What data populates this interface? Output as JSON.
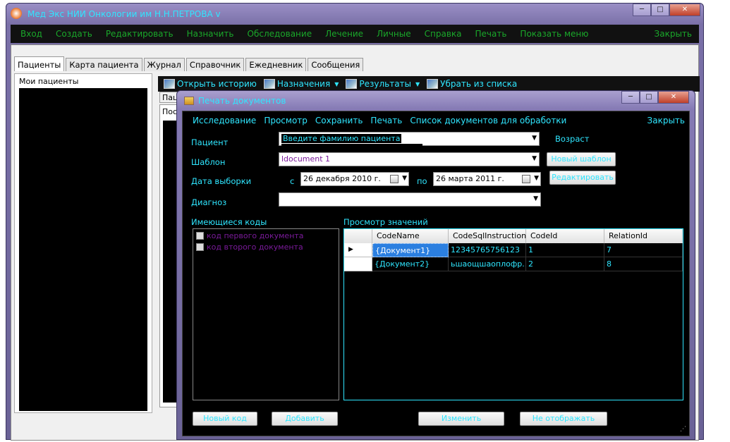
{
  "main_window": {
    "title": "Мед Экс НИИ Онкологии им Н.Н.ПЕТРОВА v",
    "menu": [
      "Вход",
      "Создать",
      "Редактировать",
      "Назначить",
      "Обследование",
      "Лечение",
      "Личные",
      "Справка",
      "Печать",
      "Показать меню"
    ],
    "close_label": "Закрыть",
    "tabs": [
      "Пациенты",
      "Карта пациента",
      "Журнал",
      "Справочник",
      "Ежедневник",
      "Сообщения"
    ],
    "left_group_label": "Мои пациенты",
    "toolbar": [
      {
        "label": "Открыть историю",
        "icon": "image-icon",
        "dropdown": false
      },
      {
        "label": "Назначения",
        "icon": "image-icon",
        "dropdown": true
      },
      {
        "label": "Результаты",
        "icon": "image-icon",
        "dropdown": true
      },
      {
        "label": "Убрать из списка",
        "icon": "image-icon",
        "dropdown": false
      }
    ],
    "subtab_fragment": "Пациенты",
    "subpanel_fragment": "Последние"
  },
  "dialog": {
    "title": "Печать документов",
    "menu": [
      "Исследование",
      "Просмотр",
      "Сохранить",
      "Печать",
      "Список документов для обработки"
    ],
    "close_label": "Закрыть",
    "patient_label": "Пациент",
    "patient_value": "Введите фамилию пациента",
    "age_label": "Возраст",
    "template_label": "Шаблон",
    "template_value": "ldocument 1",
    "new_template_button": "Новый шаблон",
    "date_label": "Дата выборки",
    "from_label": "с",
    "to_label": "по",
    "date_from": "26 декабря  2010 г.",
    "date_to": "26   марта   2011 г.",
    "edit_button": "Редактировать",
    "diagnosis_label": "Диагноз",
    "diagnosis_value": "",
    "codes_label": "Имеющиеся коды",
    "codes": [
      "код первого документа",
      "код второго документа"
    ],
    "preview_label": "Просмотр значений",
    "grid": {
      "columns": [
        "CodeName",
        "CodeSqlInstruction",
        "CodeId",
        "RelationId"
      ],
      "rows": [
        [
          "{Документ1}",
          "12345765756123",
          "1",
          "7"
        ],
        [
          "{Документ2}",
          "ьшаощшаоплофр...",
          "2",
          "8"
        ]
      ]
    },
    "buttons": {
      "new_code": "Новый код",
      "add": "Добавить",
      "change": "Изменить",
      "hide": "Не отображать"
    }
  },
  "colors": {
    "accent": "#2fe6ff",
    "menu_green": "#1aa82a",
    "code_purple": "#7a1a9a"
  }
}
